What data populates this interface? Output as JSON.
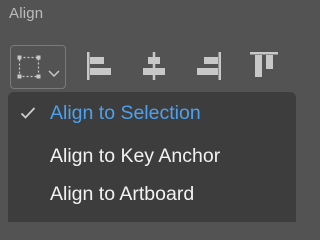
{
  "panel": {
    "title": "Align"
  },
  "toolbar": {
    "align_to_button": {
      "icon": "selection-bounds-icon",
      "dropdown_icon": "chevron-down-icon"
    },
    "tools": [
      {
        "name": "align-left-edges",
        "icon": "align-left-icon"
      },
      {
        "name": "align-horizontal-centers",
        "icon": "align-horizontal-center-icon"
      },
      {
        "name": "align-right-edges",
        "icon": "align-right-icon"
      },
      {
        "name": "align-top-edges",
        "icon": "align-top-icon"
      }
    ]
  },
  "menu": {
    "items": [
      {
        "label": "Align to Selection",
        "selected": true
      },
      {
        "label": "Align to Key Anchor",
        "selected": false
      },
      {
        "label": "Align to Artboard",
        "selected": false
      }
    ]
  },
  "colors": {
    "panel_background": "#535353",
    "menu_background": "#3d3d3d",
    "menu_text": "#f2f2f2",
    "selected_text": "#4da1ee",
    "title_text": "#bdbdbd",
    "icon": "#c8c8c8"
  }
}
